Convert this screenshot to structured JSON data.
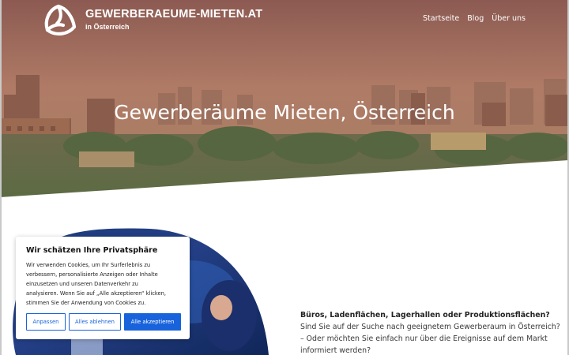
{
  "header": {
    "brand_name": "GEWERBERAEUME-MIETEN.AT",
    "brand_sub": "in Österreich",
    "nav": [
      "Startseite",
      "Blog",
      "Über uns"
    ]
  },
  "hero": {
    "title": "Gewerberäume Mieten, Österreich"
  },
  "intro": {
    "lead": "Büros, Ladenflächen, Lagerhallen oder Produktionsflächen?",
    "lines": [
      "Sind Sie auf der Suche nach geeignetem Gewerberaum in Österreich?",
      "– Oder möchten Sie einfach nur über die Ereignisse auf dem Markt",
      "informiert werden?"
    ]
  },
  "cookie": {
    "title": "Wir schätzen Ihre Privatsphäre",
    "body_lines": [
      "Wir verwenden Cookies, um Ihr Surferlebnis zu",
      "verbessern, personalisierte Anzeigen oder Inhalte",
      "einzusetzen und unseren Datenverkehr zu",
      "analysieren. Wenn Sie auf „Alle akzeptieren“ klicken,",
      "stimmen Sie der Anwendung von Cookies zu."
    ],
    "buttons": {
      "customize": "Anpassen",
      "reject": "Alles ablehnen",
      "accept": "Alle akzeptieren"
    }
  },
  "colors": {
    "accent": "#1863dc",
    "text": "#3a3a3a"
  },
  "icons": {
    "logo": "triskelion-logo-icon"
  }
}
